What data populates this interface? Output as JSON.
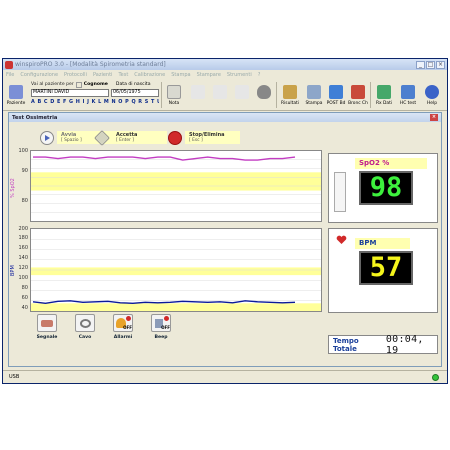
{
  "app": {
    "title": "winspiroPRO 3.0 - [Modalità Spirometria standard]",
    "menu": [
      "File",
      "Configurazione",
      "Protocolli",
      "Pazienti",
      "Test",
      "Calibrazione",
      "Stampa",
      "Stampare",
      "Strumenti",
      "?"
    ]
  },
  "toolbar": {
    "paziente_label": "Paziente",
    "search_label": "Vai al paziente per",
    "search_mode": "Cognome",
    "dob_label": "Data di nascita",
    "patient_name": "MARTINI DAVID",
    "patient_dob": "06/05/1975",
    "letters": "A B C D E F G H I J K L M N O P Q R S T U V W X Y Z",
    "buttons": [
      "Nota",
      "",
      "",
      "",
      "",
      "Risultati",
      "Stampa",
      "POST Bd",
      "Bronc Ch",
      "Rx Dati",
      "HC test",
      "Help"
    ]
  },
  "child_window": {
    "title": "Test Ossimetria",
    "controls": [
      {
        "label": "Avvia",
        "key": "[ Spazio ]"
      },
      {
        "label": "Accetta",
        "key": "[ Enter ]"
      },
      {
        "label": "Stop/Elimina",
        "key": "[ Esc ]"
      }
    ]
  },
  "spo2_chart": {
    "ylabel": "% SpO2",
    "yticks": [
      "100",
      "90",
      "80"
    ],
    "ylim": [
      78,
      101
    ],
    "band": [
      88,
      94
    ],
    "values": [
      99,
      99,
      98.5,
      99,
      99,
      98.5,
      99,
      99,
      99,
      98.5,
      99,
      99,
      98,
      98.5,
      99,
      98.5,
      98.5,
      98,
      98,
      98.5,
      98.5,
      99
    ]
  },
  "bpm_chart": {
    "ylabel": "BPM",
    "yticks": [
      "200",
      "180",
      "160",
      "140",
      "120",
      "100",
      "80",
      "60",
      "40"
    ],
    "ylim": [
      40,
      200
    ],
    "band1": [
      110,
      125
    ],
    "band2": [
      40,
      55
    ],
    "values": [
      58,
      55,
      59,
      60,
      57,
      58,
      59,
      56,
      55,
      57,
      56,
      57,
      59,
      58,
      57,
      58,
      56,
      60,
      58,
      57,
      56,
      57
    ]
  },
  "readouts": {
    "spo2_label": "SpO2  %",
    "spo2_value": "98",
    "bpm_label": "BPM",
    "bpm_value": "57"
  },
  "bottom_controls": [
    {
      "label": "Segnale"
    },
    {
      "label": "Cavo"
    },
    {
      "label": "Allarmi",
      "state": "OFF"
    },
    {
      "label": "Beep",
      "state": "OFF"
    }
  ],
  "totals": {
    "label": "Tempo Totale",
    "value": "00:04, 19"
  },
  "status": {
    "port": "USB"
  },
  "colors": {
    "spo2_line": "#c23cc2",
    "bpm_line": "#0b1a9a",
    "band": "#ffff99",
    "lcd_text": "#3df03d",
    "lcd_text_bpm": "#f5f51c"
  }
}
